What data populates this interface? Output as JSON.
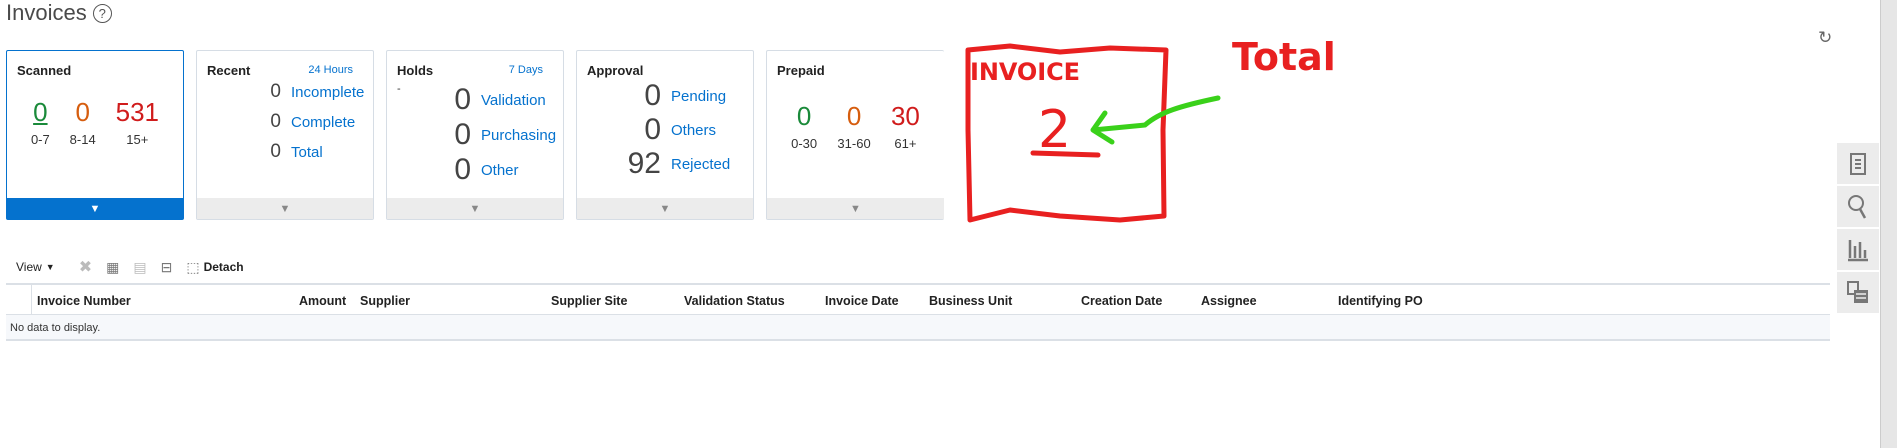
{
  "page": {
    "title": "Invoices",
    "help_icon": "?",
    "refresh_icon": "refresh-icon"
  },
  "cards": {
    "scanned": {
      "title": "Scanned",
      "values": [
        "0",
        "0",
        "531"
      ],
      "labels": [
        "0-7",
        "8-14",
        "15+"
      ]
    },
    "recent": {
      "title": "Recent",
      "period": "24 Hours",
      "rows": [
        {
          "value": "0",
          "label": "Incomplete"
        },
        {
          "value": "0",
          "label": "Complete"
        },
        {
          "value": "0",
          "label": "Total"
        }
      ]
    },
    "holds": {
      "title": "Holds",
      "period": "7 Days",
      "dash": "-",
      "rows": [
        {
          "value": "0",
          "label": "Validation"
        },
        {
          "value": "0",
          "label": "Purchasing"
        },
        {
          "value": "0",
          "label": "Other"
        }
      ]
    },
    "approval": {
      "title": "Approval",
      "rows": [
        {
          "value": "0",
          "label": "Pending"
        },
        {
          "value": "0",
          "label": "Others"
        },
        {
          "value": "92",
          "label": "Rejected"
        }
      ]
    },
    "prepaid": {
      "title": "Prepaid",
      "values": [
        "0",
        "0",
        "30"
      ],
      "labels": [
        "0-30",
        "31-60",
        "61+"
      ]
    }
  },
  "annotation": {
    "box_label": "INVOICE",
    "value": "2",
    "side_label": "Total",
    "colors": {
      "red": "#e82020",
      "green": "#3ad11a"
    }
  },
  "toolbar": {
    "view": "View",
    "detach": "Detach"
  },
  "table": {
    "columns": [
      "Invoice Number",
      "Amount",
      "Supplier",
      "Supplier Site",
      "Validation Status",
      "Invoice Date",
      "Business Unit",
      "Creation Date",
      "Assignee",
      "Identifying PO"
    ],
    "empty_text": "No data to display."
  }
}
